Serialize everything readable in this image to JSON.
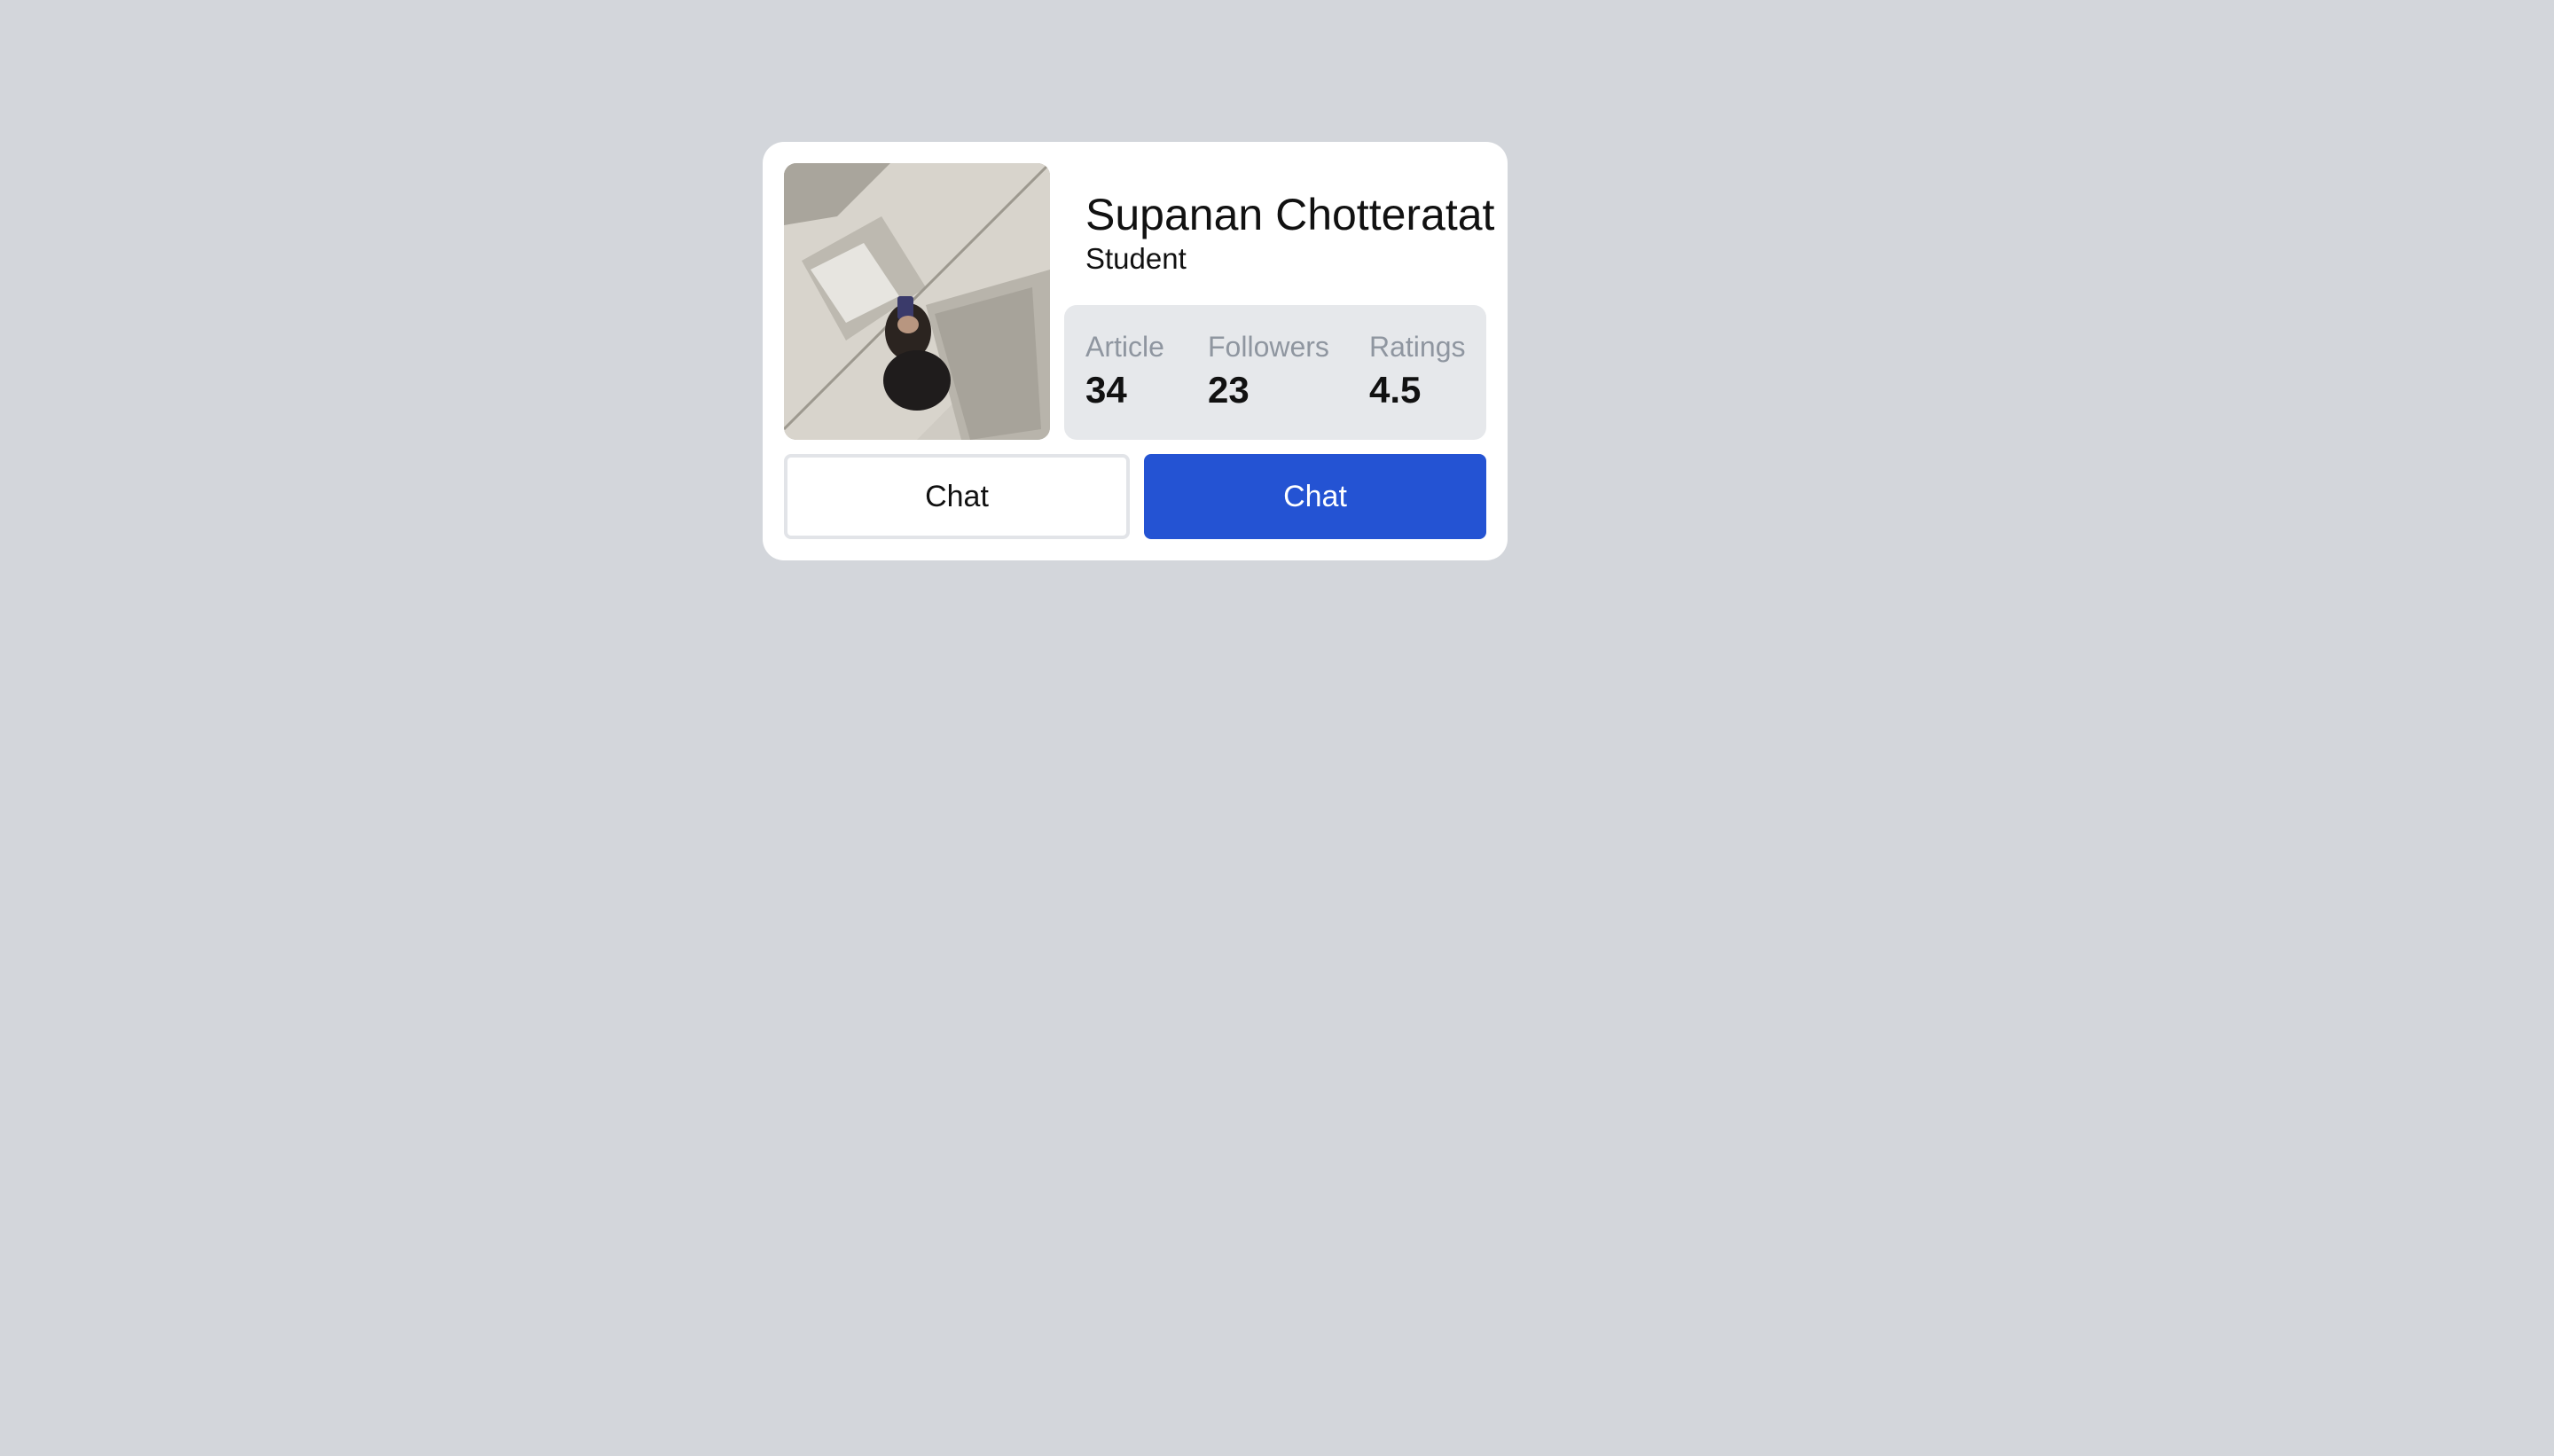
{
  "profile": {
    "name": "Supanan Chotteratat",
    "role": "Student",
    "avatar_alt": "profile photo"
  },
  "stats": [
    {
      "label": "Article",
      "value": "34"
    },
    {
      "label": "Followers",
      "value": "23"
    },
    {
      "label": "Ratings",
      "value": "4.5"
    }
  ],
  "actions": {
    "secondary_label": "Chat",
    "primary_label": "Chat"
  },
  "colors": {
    "background": "#d3d6db",
    "card": "#ffffff",
    "stats_panel": "#e6e8eb",
    "primary": "#2453d3",
    "muted_text": "#8f96a0"
  }
}
